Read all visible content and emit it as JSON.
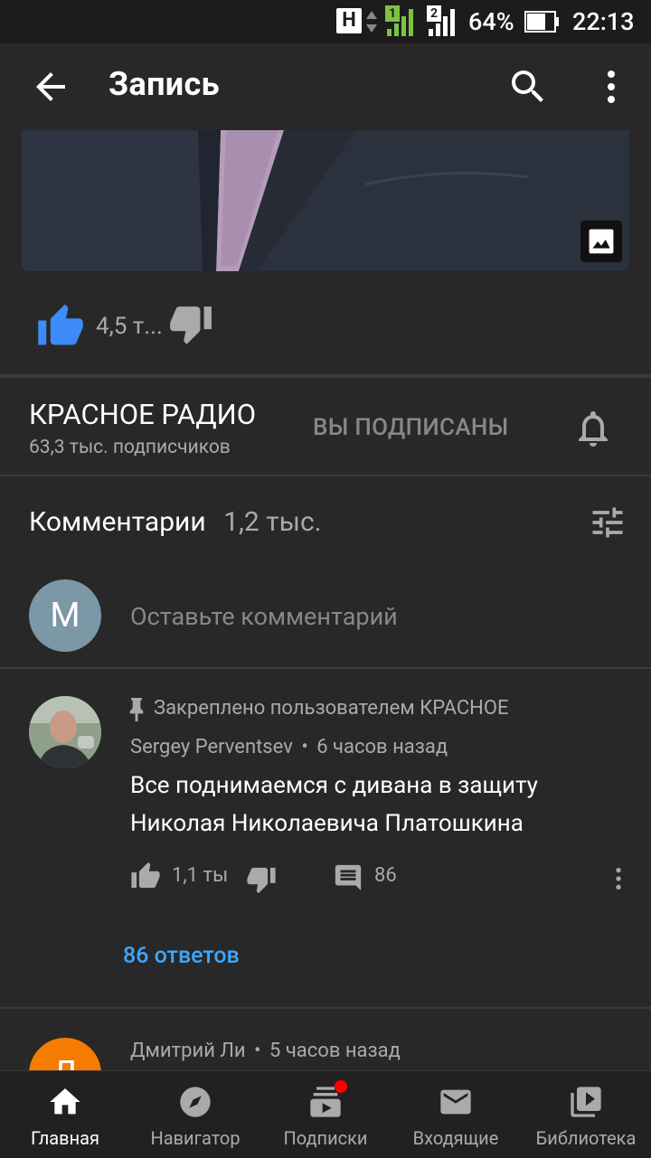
{
  "status_bar": {
    "sim1": "1",
    "sim2": "2",
    "network": "H",
    "battery_percent": "64%",
    "time": "22:13"
  },
  "app_bar": {
    "title": "Запись"
  },
  "post": {
    "likes": "4,5 т...",
    "image_icon": "image-icon"
  },
  "channel": {
    "name": "КРАСНОЕ РАДИО",
    "subscribers": "63,3 тыс. подписчиков",
    "subscribed_label": "ВЫ ПОДПИСАНЫ"
  },
  "comments": {
    "header": "Комментарии",
    "count": "1,2 тыс.",
    "composer": {
      "avatar_letter": "M",
      "placeholder": "Оставьте комментарий"
    },
    "items": [
      {
        "pinned_label": "Закреплено пользователем КРАСНОЕ",
        "author": "Sergey Perventsev",
        "separator": "•",
        "time": "6 часов назад",
        "text_line1": "Все поднимаемся с дивана в защиту",
        "text_line2": "Николая Николаевича Платошкина",
        "likes": "1,1 ты",
        "replies_count": "86",
        "replies_link": "86 ответов"
      },
      {
        "avatar_letter": "Д",
        "author": "Дмитрий Ли",
        "separator": "•",
        "time": "5 часов назад"
      }
    ]
  },
  "bottom_nav": [
    {
      "label": "Главная",
      "active": true
    },
    {
      "label": "Навигатор",
      "active": false
    },
    {
      "label": "Подписки",
      "active": false
    },
    {
      "label": "Входящие",
      "active": false
    },
    {
      "label": "Библиотека",
      "active": false
    }
  ],
  "colors": {
    "background": "#282828",
    "accent_blue": "#3ea6ff",
    "like_blue": "#3e8af8",
    "muted": "#aaaaaa",
    "composer_avatar": "#7c97a5",
    "second_avatar": "#f57c00",
    "notification_dot": "#ff0000"
  }
}
